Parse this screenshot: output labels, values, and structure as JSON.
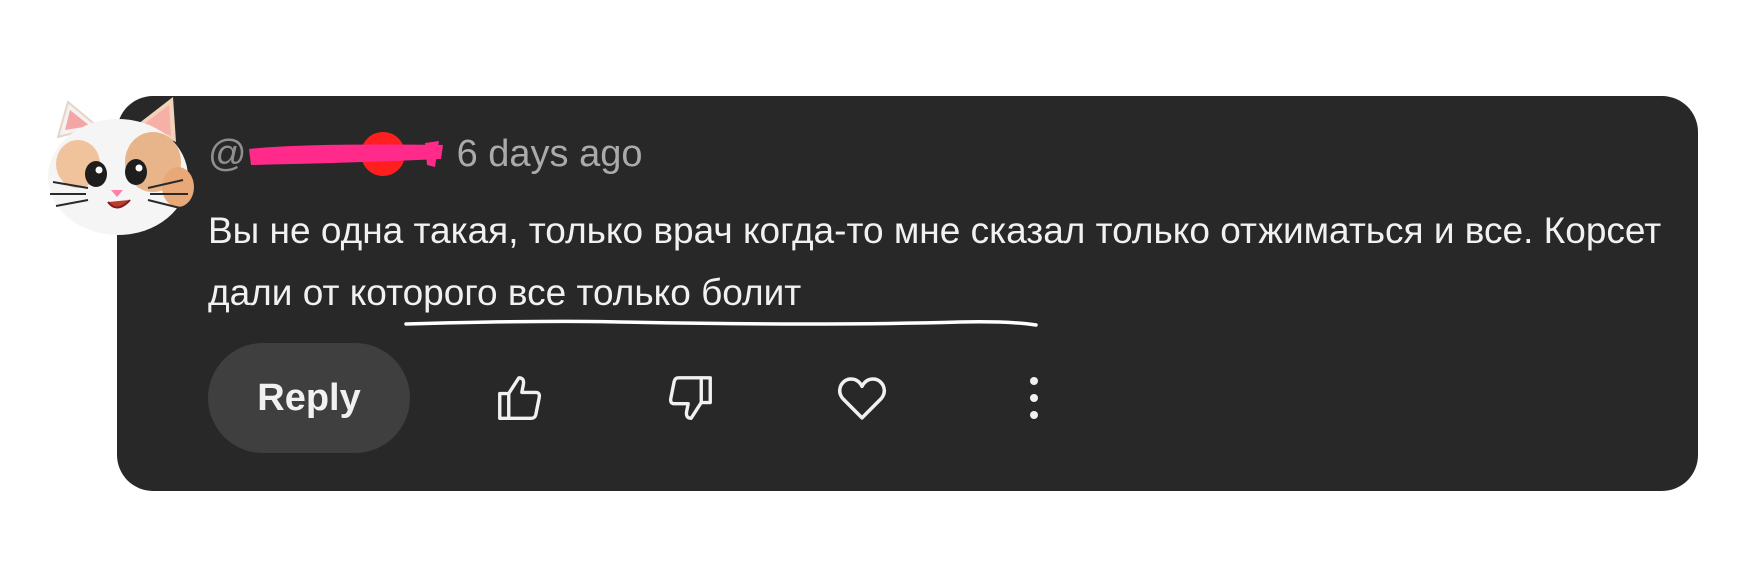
{
  "comment": {
    "author_prefix": "@",
    "timestamp": "6 days ago",
    "text": "Вы не одна такая, только врач когда-то мне сказал только отжиматься и все. Корсет дали от которого все только болит"
  },
  "actions": {
    "reply_label": "Reply",
    "like_icon": "thumbs-up-icon",
    "dislike_icon": "thumbs-down-icon",
    "heart_icon": "heart-icon",
    "more_icon": "more-vertical-icon"
  },
  "colors": {
    "card_bg": "#282828",
    "text": "#f1f1f1",
    "muted": "#aaaaaa",
    "button_bg": "#3f3f3f",
    "redaction": "#ff2a8a"
  }
}
